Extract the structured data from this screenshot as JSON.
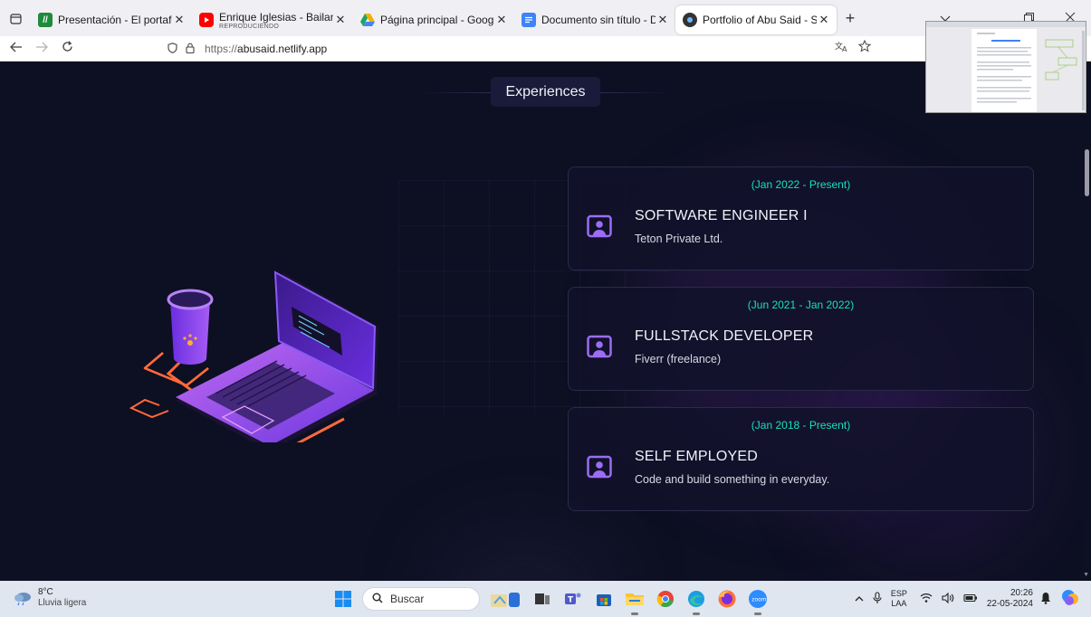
{
  "browser": {
    "tabs": [
      {
        "title": "Presentación - El portafolio de",
        "icon": "green-slides-icon",
        "color": "#1f8a3c",
        "sub": ""
      },
      {
        "title": "Enrique Iglesias - Bailando ft. S",
        "icon": "youtube-icon",
        "color": "#ff0000",
        "sub": "REPRODUCIENDO"
      },
      {
        "title": "Página principal - Google Drive",
        "icon": "google-drive-icon",
        "color": "#f2b100",
        "sub": ""
      },
      {
        "title": "Documento sin título - Docume",
        "icon": "google-docs-icon",
        "color": "#3f83f8",
        "sub": ""
      },
      {
        "title": "Portfolio of Abu Said - Softwar",
        "icon": "portfolio-favicon",
        "color": "#333333",
        "sub": ""
      }
    ],
    "close_glyph": "✕",
    "new_tab_glyph": "+",
    "url_prefix": "https://",
    "url_host": "abusaid.netlify.app"
  },
  "page": {
    "section_title": "Experiences",
    "experiences": [
      {
        "date": "(Jan 2022 - Present)",
        "role": "SOFTWARE ENGINEER I",
        "company": "Teton Private Ltd."
      },
      {
        "date": "(Jun 2021 - Jan 2022)",
        "role": "FULLSTACK DEVELOPER",
        "company": "Fiverr (freelance)"
      },
      {
        "date": "(Jan 2018 - Present)",
        "role": "SELF EMPLOYED",
        "company": "Code and build something in everyday."
      }
    ],
    "accent_color": "#16e0bd",
    "icon_color": "#9b6cf5"
  },
  "taskbar": {
    "temperature": "8°C",
    "condition": "Lluvia ligera",
    "search_label": "Buscar",
    "lang_top": "ESP",
    "lang_bottom": "LAA",
    "time": "20:26",
    "date": "22-05-2024"
  }
}
